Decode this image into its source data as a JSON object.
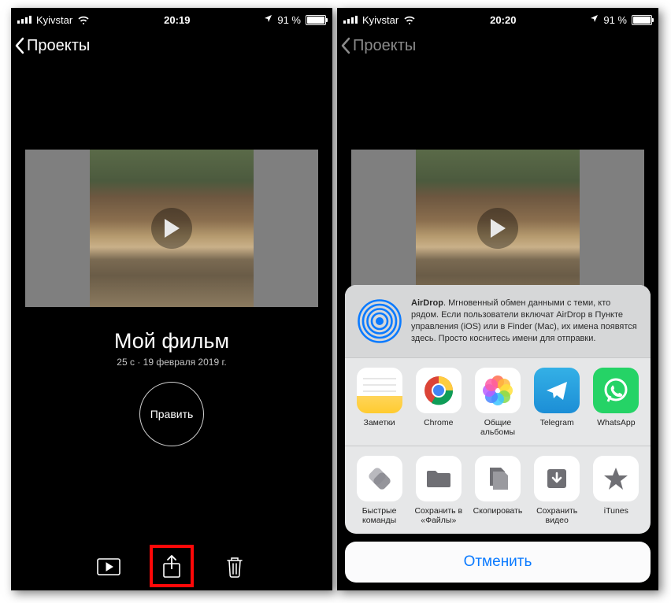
{
  "status": {
    "carrier": "Kyivstar",
    "battery_pct": "91 %",
    "battery_fill_pct": 91
  },
  "left": {
    "time": "20:19",
    "nav_back": "Проекты",
    "title": "Мой фильм",
    "meta": "25 с · 19 февраля 2019 г.",
    "edit": "Править"
  },
  "right": {
    "time": "20:20",
    "nav_back": "Проекты",
    "airdrop_label": "AirDrop",
    "airdrop_text": ". Мгновенный обмен данными с теми, кто рядом. Если пользователи включат AirDrop в Пункте управления (iOS) или в Finder (Mac), их имена появятся здесь. Просто коснитесь имени для отправки.",
    "apps": [
      {
        "label": "Заметки"
      },
      {
        "label": "Chrome"
      },
      {
        "label": "Общие альбомы"
      },
      {
        "label": "Telegram"
      },
      {
        "label": "WhatsApp"
      }
    ],
    "actions": [
      {
        "label": "Быстрые команды"
      },
      {
        "label": "Сохранить в «Файлы»"
      },
      {
        "label": "Скопировать"
      },
      {
        "label": "Сохранить видео"
      },
      {
        "label": "iTunes"
      }
    ],
    "cancel": "Отменить"
  }
}
